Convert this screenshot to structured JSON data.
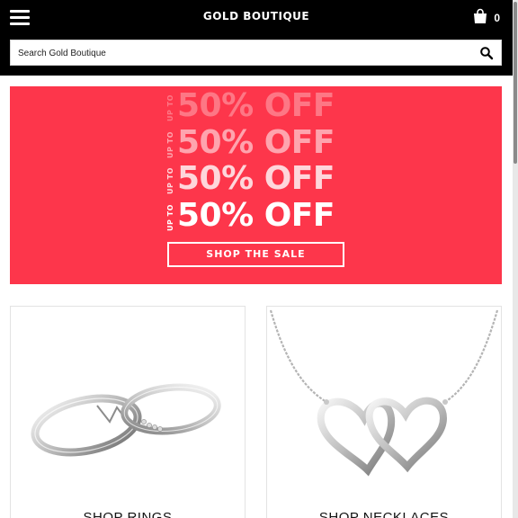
{
  "header": {
    "brand": "GOLD BOUTIQUE",
    "menu_icon": "hamburger-menu-icon",
    "cart_icon": "shopping-bag-icon",
    "cart_count": "0"
  },
  "search": {
    "placeholder": "Search Gold Boutique",
    "icon": "search-icon"
  },
  "banner": {
    "background": "#fd364b",
    "lines": [
      {
        "prefix": "UP TO",
        "text": "50% OFF"
      },
      {
        "prefix": "UP TO",
        "text": "50% OFF"
      },
      {
        "prefix": "UP TO",
        "text": "50% OFF"
      },
      {
        "prefix": "UP TO",
        "text": "50% OFF"
      }
    ],
    "cta": "SHOP THE SALE"
  },
  "categories": [
    {
      "label": "SHOP RINGS",
      "image": "silver-rings-image"
    },
    {
      "label": "SHOP NECKLACES",
      "image": "heart-necklace-image"
    }
  ]
}
